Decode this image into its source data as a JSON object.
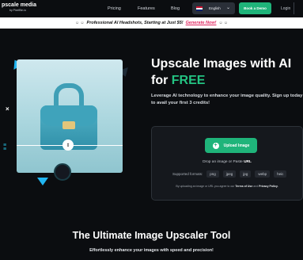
{
  "nav": {
    "logo_main": "pscale media",
    "logo_sub": "by PixelBin.io",
    "links": [
      "Pricing",
      "Features",
      "Blog"
    ],
    "language": "English",
    "demo_button": "Book a Demo",
    "login": "Login"
  },
  "promo": {
    "text": "Professional AI Headshots, Starting at Just $5!",
    "link": "Generate Now!"
  },
  "hero": {
    "title_line1": "Upscale Images with AI",
    "title_for": "for",
    "title_free": "FREE",
    "subtitle": "Leverage AI technology to enhance your image quality. Sign up today to avail your first 3 credits!"
  },
  "upload": {
    "button": "Upload Image",
    "drop_text": "Drop an image or Paste",
    "drop_url": "URL",
    "formats_label": "Supported formats:",
    "formats": [
      "png",
      "jpeg",
      "jpg",
      "webp",
      "heic"
    ],
    "terms_prefix": "By uploading an image or URL you agree to our",
    "terms_link": "Terms of Use",
    "terms_and": "and",
    "privacy_link": "Privacy Policy."
  },
  "section": {
    "title": "The Ultimate Image Upscaler Tool",
    "subtitle": "Effortlessly enhance your images with speed and precision!"
  },
  "colors": {
    "accent_green": "#23c382",
    "button_green": "#1fb47a",
    "promo_pink": "#e0245e",
    "deco_blue": "#21b6f2"
  }
}
